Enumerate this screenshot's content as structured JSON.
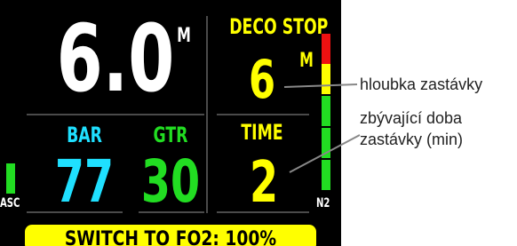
{
  "depth": {
    "value": "6.0",
    "unit": "M"
  },
  "deco_stop": {
    "label": "DECO STOP",
    "depth": "6",
    "unit": "M",
    "time_label": "TIME",
    "time": "2"
  },
  "gas": {
    "bar_label": "BAR",
    "bar_value": "77",
    "gtr_label": "GTR",
    "gtr_value": "30"
  },
  "ascent": {
    "label": "ASC",
    "level_fraction": 0.2
  },
  "n2": {
    "label": "N2"
  },
  "status_banner": "SWITCH TO FO2: 100%",
  "callouts": {
    "stop_depth": "hloubka zastávky",
    "stop_time_line1": "zbývající doba",
    "stop_time_line2": "zastávky (min)"
  },
  "colors": {
    "white": "#ffffff",
    "yellow": "#ffff00",
    "cyan": "#1fe0ff",
    "green": "#22dd22",
    "red": "#ee1111",
    "banner": "#ffff00"
  }
}
